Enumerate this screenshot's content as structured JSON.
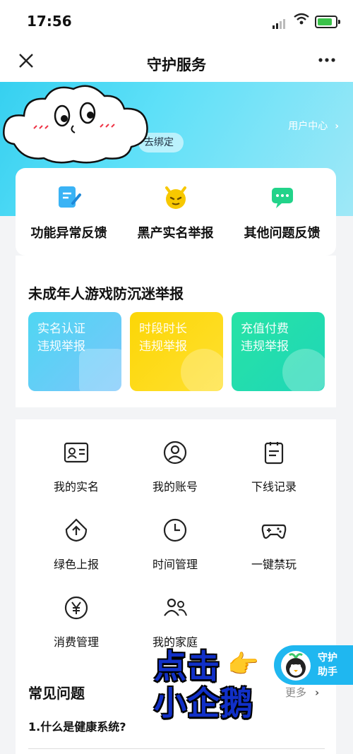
{
  "status_bar": {
    "time": "17:56"
  },
  "nav": {
    "title": "守护服务",
    "close_icon": "close-icon",
    "more_icon": "more-dots-icon"
  },
  "banner": {
    "user_center": "用户中心",
    "bind_text": "去绑定"
  },
  "quick_actions": [
    {
      "label": "功能异常反馈",
      "icon": "edit-document-icon",
      "color": "#3ab3f5"
    },
    {
      "label": "黑产实名举报",
      "icon": "devil-face-icon",
      "color": "#f7c800"
    },
    {
      "label": "其他问题反馈",
      "icon": "chat-bubble-icon",
      "color": "#22d38a"
    }
  ],
  "minor_section": {
    "title": "未成年人游戏防沉迷举报",
    "tiles": [
      {
        "line1": "实名认证",
        "line2": "违规举报",
        "color": "#4fd6f2"
      },
      {
        "line1": "时段时长",
        "line2": "违规举报",
        "color": "#fcd606"
      },
      {
        "line1": "充值付费",
        "line2": "违规举报",
        "color": "#27e3a5"
      }
    ]
  },
  "grid": [
    {
      "label": "我的实名",
      "icon": "id-card-icon"
    },
    {
      "label": "我的账号",
      "icon": "user-circle-icon"
    },
    {
      "label": "下线记录",
      "icon": "clipboard-icon"
    },
    {
      "label": "绿色上报",
      "icon": "upload-shield-icon"
    },
    {
      "label": "时间管理",
      "icon": "clock-icon"
    },
    {
      "label": "一键禁玩",
      "icon": "gamepad-icon"
    },
    {
      "label": "消费管理",
      "icon": "yuan-coin-icon"
    },
    {
      "label": "我的家庭",
      "icon": "family-icon"
    }
  ],
  "faq": {
    "title": "常见问题",
    "more": "更多",
    "items": [
      "1.什么是健康系统?"
    ]
  },
  "helper": {
    "line1": "守护",
    "line2": "助手"
  },
  "promo": {
    "line1": "点击",
    "line2": "小企鹅"
  }
}
